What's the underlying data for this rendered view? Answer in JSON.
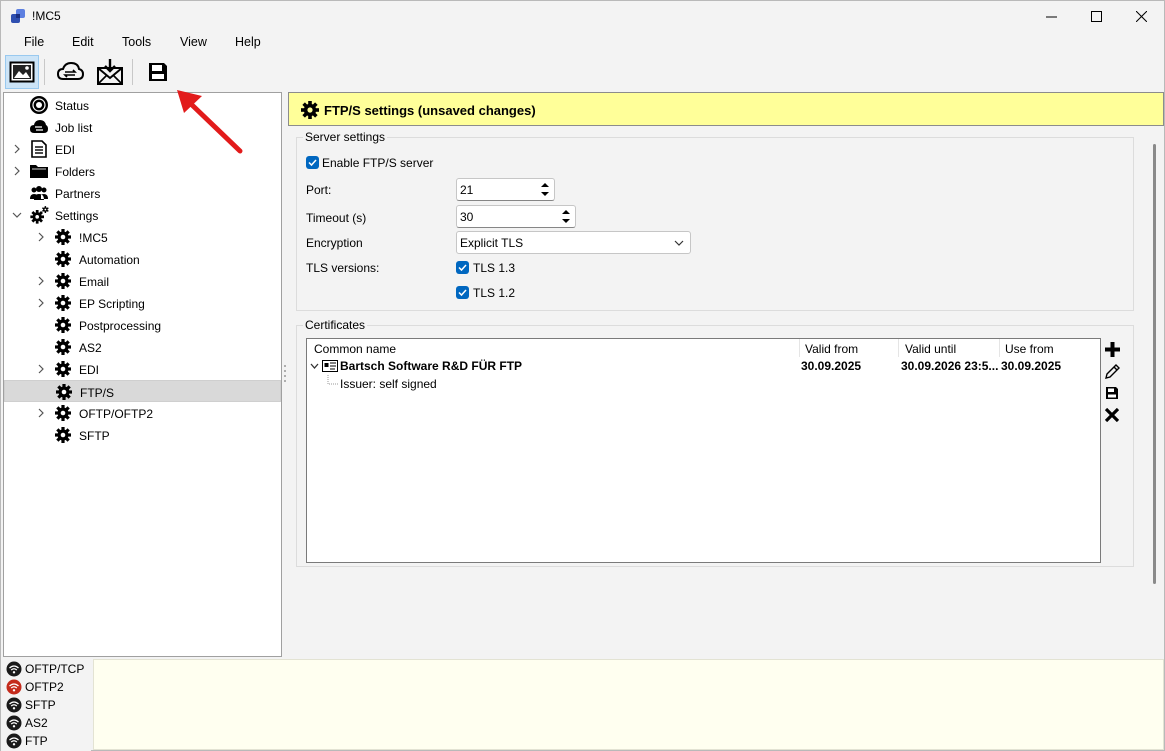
{
  "window": {
    "title": "!MC5"
  },
  "menu": [
    "File",
    "Edit",
    "Tools",
    "View",
    "Help"
  ],
  "toolbar": {
    "buttons": [
      {
        "icon": "picture-frame-icon",
        "active": true
      },
      {
        "icon": "cloud-sync-icon"
      },
      {
        "icon": "mail-download-icon"
      },
      {
        "icon": "save-icon"
      }
    ]
  },
  "tree": [
    {
      "label": "Status",
      "icon": "status-icon",
      "level": 0,
      "chevron": ""
    },
    {
      "label": "Job list",
      "icon": "cloud-sync-icon",
      "level": 0,
      "chevron": ""
    },
    {
      "label": "EDI",
      "icon": "document-icon",
      "level": 0,
      "chevron": "right"
    },
    {
      "label": "Folders",
      "icon": "folder-icon",
      "level": 0,
      "chevron": "right"
    },
    {
      "label": "Partners",
      "icon": "people-icon",
      "level": 0,
      "chevron": ""
    },
    {
      "label": "Settings",
      "icon": "gears-icon",
      "level": 0,
      "chevron": "down"
    },
    {
      "label": "!MC5",
      "icon": "gear-icon",
      "level": 1,
      "chevron": "right"
    },
    {
      "label": "Automation",
      "icon": "gear-icon",
      "level": 1,
      "chevron": ""
    },
    {
      "label": "Email",
      "icon": "gear-icon",
      "level": 1,
      "chevron": "right"
    },
    {
      "label": "EP Scripting",
      "icon": "gear-icon",
      "level": 1,
      "chevron": "right"
    },
    {
      "label": "Postprocessing",
      "icon": "gear-icon",
      "level": 1,
      "chevron": ""
    },
    {
      "label": "AS2",
      "icon": "gear-icon",
      "level": 1,
      "chevron": ""
    },
    {
      "label": "EDI",
      "icon": "gear-icon",
      "level": 1,
      "chevron": "right"
    },
    {
      "label": "FTP/S",
      "icon": "gear-icon",
      "level": 1,
      "chevron": "",
      "selected": true
    },
    {
      "label": "OFTP/OFTP2",
      "icon": "gear-icon",
      "level": 1,
      "chevron": "right"
    },
    {
      "label": "SFTP",
      "icon": "gear-icon",
      "level": 1,
      "chevron": ""
    }
  ],
  "banner": {
    "title": "FTP/S settings (unsaved changes)",
    "color": "#ffff99"
  },
  "server": {
    "group_title": "Server settings",
    "enable_label": "Enable FTP/S server",
    "enable_checked": true,
    "port_label": "Port:",
    "port_value": "21",
    "timeout_label": "Timeout (s)",
    "timeout_value": "30",
    "encryption_label": "Encryption",
    "encryption_value": "Explicit TLS",
    "tls_label": "TLS versions:",
    "tls13_label": "TLS 1.3",
    "tls13_checked": true,
    "tls12_label": "TLS 1.2",
    "tls12_checked": true
  },
  "certificates": {
    "group_title": "Certificates",
    "columns": [
      "Common name",
      "Valid from",
      "Valid until",
      "Use from"
    ],
    "row": {
      "name": "Bartsch Software R&D FÜR FTP",
      "valid_from": "30.09.2025",
      "valid_until": "30.09.2026 23:5...",
      "use_from": "30.09.2025",
      "child": "Issuer: self signed"
    },
    "tools": [
      "add-icon",
      "edit-icon",
      "save-icon",
      "delete-icon"
    ]
  },
  "connections": [
    {
      "label": "OFTP/TCP",
      "status_color": "#1a1a1a"
    },
    {
      "label": "OFTP2",
      "status_color": "#c42b1c"
    },
    {
      "label": "SFTP",
      "status_color": "#1a1a1a"
    },
    {
      "label": "AS2",
      "status_color": "#1a1a1a"
    },
    {
      "label": "FTP",
      "status_color": "#1a1a1a"
    }
  ],
  "accent_color": "#0067c0"
}
